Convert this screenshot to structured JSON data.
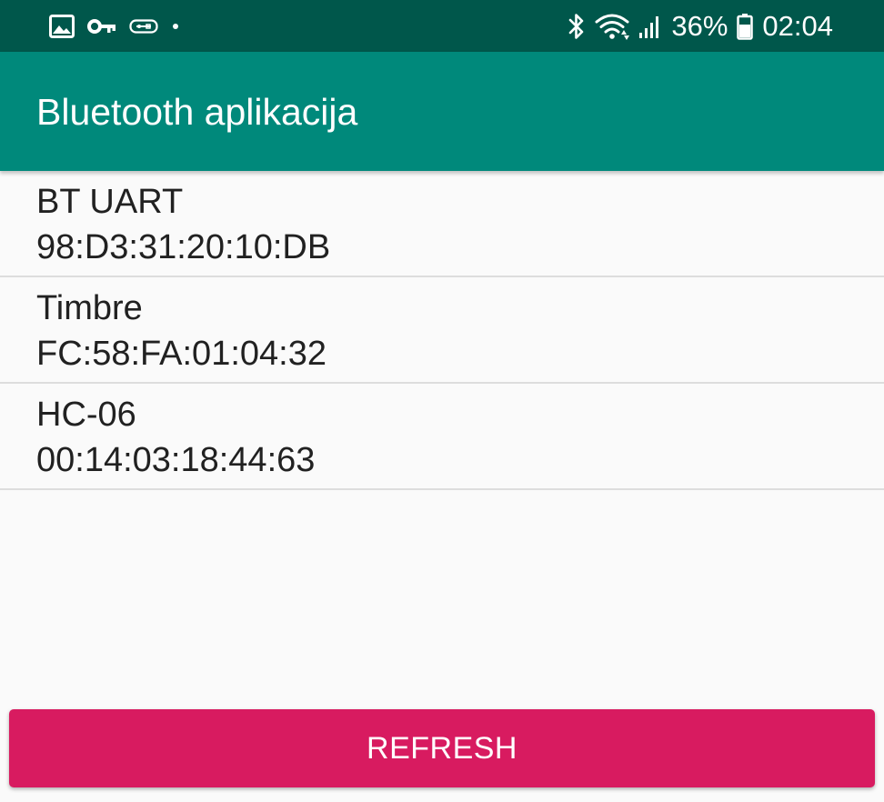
{
  "status_bar": {
    "left_icons": [
      "image-icon",
      "key-icon",
      "usb-icon",
      "dot-icon"
    ],
    "right_icons": [
      "bluetooth-icon",
      "wifi-icon",
      "signal-icon",
      "battery-icon"
    ],
    "battery_percent": "36%",
    "time": "02:04"
  },
  "app_bar": {
    "title": "Bluetooth aplikacija"
  },
  "devices": [
    {
      "name": "BT UART",
      "mac": "98:D3:31:20:10:DB"
    },
    {
      "name": "Timbre",
      "mac": "FC:58:FA:01:04:32"
    },
    {
      "name": "HC-06",
      "mac": "00:14:03:18:44:63"
    }
  ],
  "refresh_button": {
    "label": "REFRESH"
  },
  "colors": {
    "status_bar": "#00574B",
    "app_bar": "#00897B",
    "accent": "#D81B60",
    "background": "#FAFAFA",
    "divider": "#DDDDDD"
  }
}
